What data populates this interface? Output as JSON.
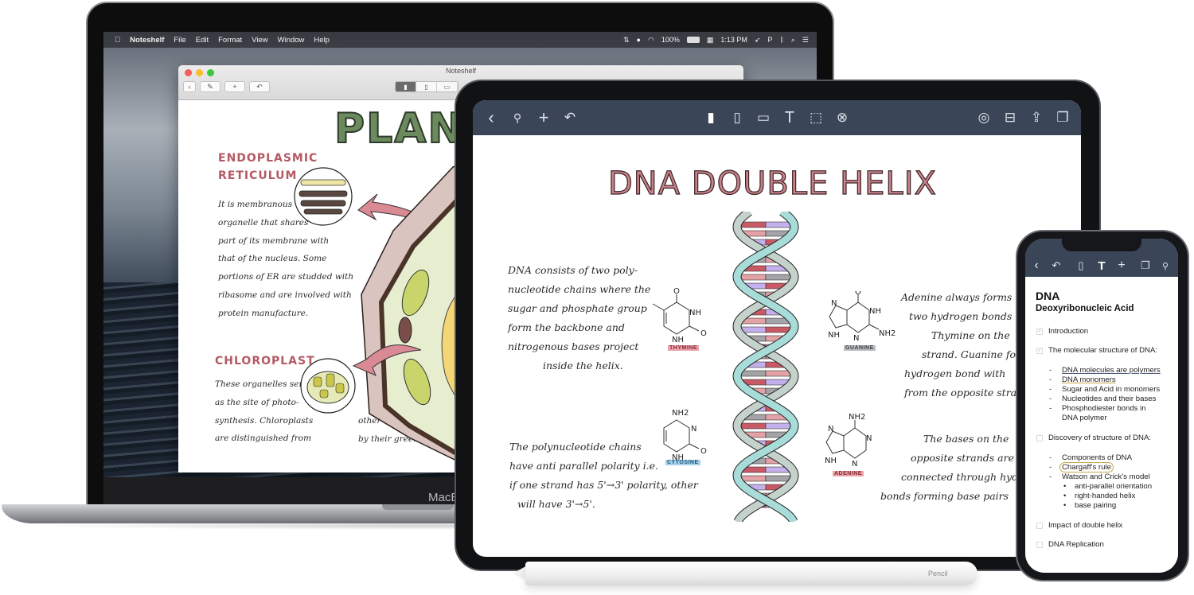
{
  "macbook": {
    "chin_label": "MacBook",
    "menubar": {
      "apple": "",
      "app_name": "Noteshelf",
      "menus": [
        "File",
        "Edit",
        "Format",
        "View",
        "Window",
        "Help"
      ],
      "status": {
        "battery": "100%",
        "time": "1:13 PM",
        "icons": [
          "dropbox-icon",
          "spotify-icon",
          "wifi-icon",
          "battery-icon",
          "app-icon",
          "rocket-icon",
          "p-icon",
          "bluetooth-icon",
          "search-icon",
          "list-icon"
        ]
      }
    },
    "window": {
      "title": "Noteshelf",
      "toolbar": {
        "back": "‹",
        "settings": "✎",
        "add": "+",
        "undo": "↶",
        "tools": [
          "pen",
          "highlighter",
          "eraser"
        ]
      },
      "note": {
        "title": "PLANT",
        "sections": [
          {
            "heading": [
              "ENDOPLASMIC",
              "RETICULUM"
            ],
            "lines": [
              "It is membranous",
              "organelle that shares",
              "part of its membrane with",
              "that of the nucleus. Some",
              "portions of ER are studded with",
              "ribasome and are involved with",
              "protein manufacture."
            ]
          },
          {
            "heading": [
              "CHLOROPLAST"
            ],
            "lines": [
              "These organelles serve",
              "as the site of photo-",
              "synthesis. Chloroplasts",
              "are distinguished from"
            ],
            "lines_right": [
              "other types of plastids",
              "by their green color."
            ]
          }
        ]
      }
    }
  },
  "ipad": {
    "toolbar": {
      "left": [
        "back-icon",
        "wrench-icon",
        "add-icon",
        "undo-icon"
      ],
      "center": [
        "pen-icon",
        "highlighter-icon",
        "eraser-icon",
        "text-icon",
        "lasso-icon",
        "shapes-icon"
      ],
      "right": [
        "shapes-overlap-icon",
        "stamp-icon",
        "share-icon",
        "pages-icon"
      ],
      "glyphs": {
        "back": "‹",
        "wrench": "🔧",
        "add": "+",
        "undo": "↶",
        "pen": "▮",
        "highlighter": "▯",
        "eraser": "▭",
        "text": "T",
        "lasso": "⬚",
        "shapes": "⊗",
        "overlap": "◎",
        "stamp": "⊟",
        "share": "⇪",
        "pages": "❐"
      }
    },
    "note": {
      "title": "DNA DOUBLE HELIX",
      "paragraph1": [
        "DNA consists of two poly-",
        "nucleotide chains where the",
        "sugar and phosphate group",
        "form the backbone and",
        "nitrogenous bases project",
        "inside the helix."
      ],
      "paragraph2": [
        "The polynucleotide chains",
        "have anti parallel polarity i.e.",
        "if one strand has 5'→3' polarity, other",
        "will have 3'→5'."
      ],
      "paragraph3": [
        "Adenine always forms",
        "two hydrogen bonds with",
        "Thymine on the",
        "strand. Guanine forms",
        "hydrogen bond with",
        "from the opposite strand"
      ],
      "paragraph4": [
        "The bases on the",
        "opposite strands are",
        "connected through hydrogen",
        "bonds forming base pairs"
      ],
      "molecules": {
        "thymine": {
          "label": "THYMINE",
          "atoms": [
            "O",
            "NH",
            "NH",
            "O"
          ],
          "highlight": "#e9a5aa"
        },
        "guanine": {
          "label": "GUANINE",
          "atoms": [
            "O",
            "N",
            "NH",
            "NH",
            "N",
            "NH2"
          ],
          "highlight": "#b9bec4"
        },
        "cytosine": {
          "label": "CYTOSINE",
          "atoms": [
            "NH2",
            "N",
            "NH",
            "O"
          ],
          "highlight": "#a9cfe6"
        },
        "adenine": {
          "label": "ADENINE",
          "atoms": [
            "NH2",
            "N",
            "N",
            "NH",
            "N"
          ],
          "highlight": "#e9a5aa"
        }
      },
      "helix_colors": {
        "backbone": "#a8dcd8",
        "backbone_back": "#c4d2cb",
        "pairs": [
          "#c85a66",
          "#e3a2a6",
          "#c4b0ec",
          "#a4a4a8"
        ]
      }
    }
  },
  "pencil": {
    "label": "Pencil"
  },
  "iphone": {
    "toolbar": {
      "icons": [
        "back-icon",
        "undo-icon",
        "pen-icon",
        "text-icon",
        "add-icon",
        "pages-icon",
        "wrench-icon"
      ],
      "glyphs": [
        "‹",
        "↶",
        "▯",
        "T",
        "+",
        "❐",
        "🔧"
      ]
    },
    "note": {
      "title": "DNA",
      "subtitle": "Deoxyribonucleic Acid",
      "items": [
        {
          "text": "Introduction",
          "checked": true
        },
        {
          "text": "The molecular structure of DNA:",
          "checked": true,
          "sub": [
            "DNA molecules are polymers",
            "DNA monomers",
            "Sugar and Acid in monomers",
            "Nucleotides and their bases",
            "Phosphodiester bonds in",
            "DNA polymer"
          ]
        },
        {
          "text": "Discovery of structure of DNA:",
          "checked": false,
          "sub": [
            "Components of DNA",
            "Chargaff's rule",
            "Watson and Crick's model"
          ],
          "bullets": [
            "anti-parallel orientation",
            "right-handed helix",
            "base pairing"
          ]
        },
        {
          "text": "Impact of double helix",
          "checked": false
        },
        {
          "text": "DNA Replication",
          "checked": false
        }
      ],
      "check_mark": "✓",
      "dash": "-",
      "bullet": "•"
    }
  }
}
